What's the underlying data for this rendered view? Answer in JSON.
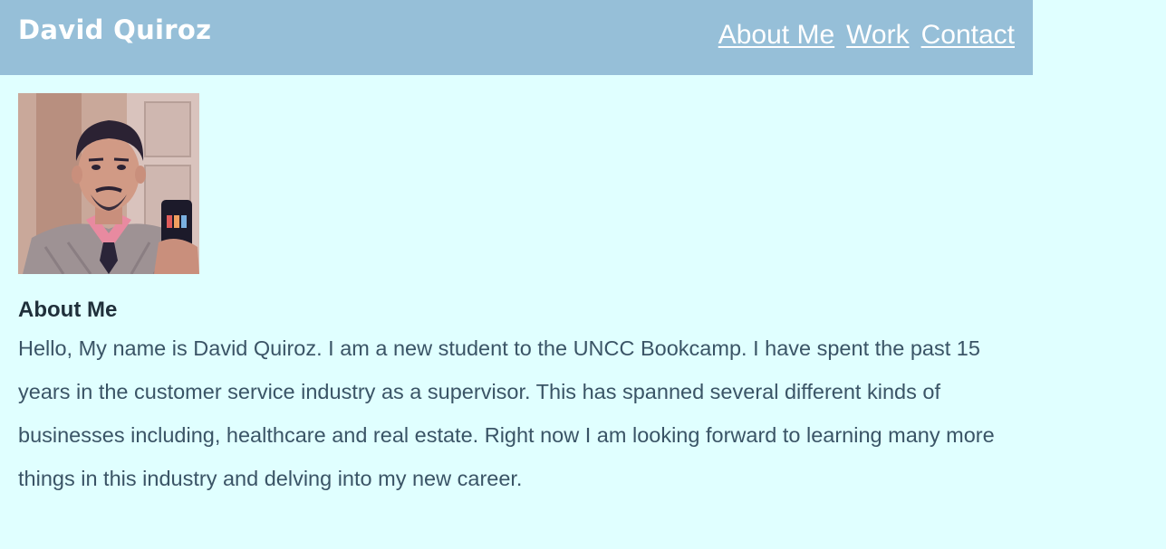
{
  "header": {
    "brand": "David Quiroz",
    "nav": [
      {
        "label": "About Me"
      },
      {
        "label": "Work"
      },
      {
        "label": "Contact"
      }
    ]
  },
  "colors": {
    "header_bg": "#96bfd8",
    "page_bg": "#e0ffff",
    "header_text": "#ffffff",
    "body_text": "#3a5466"
  },
  "main": {
    "avatar_icon": "profile-photo",
    "about_heading": "About Me",
    "about_text": "Hello, My name is David Quiroz. I am a new student to the UNCC Bookcamp. I have spent the past 15 years in the customer service industry as a supervisor. This has spanned several different kinds of businesses including, healthcare and real estate. Right now I am looking forward to learning many more things in this industry and delving into my new career."
  }
}
